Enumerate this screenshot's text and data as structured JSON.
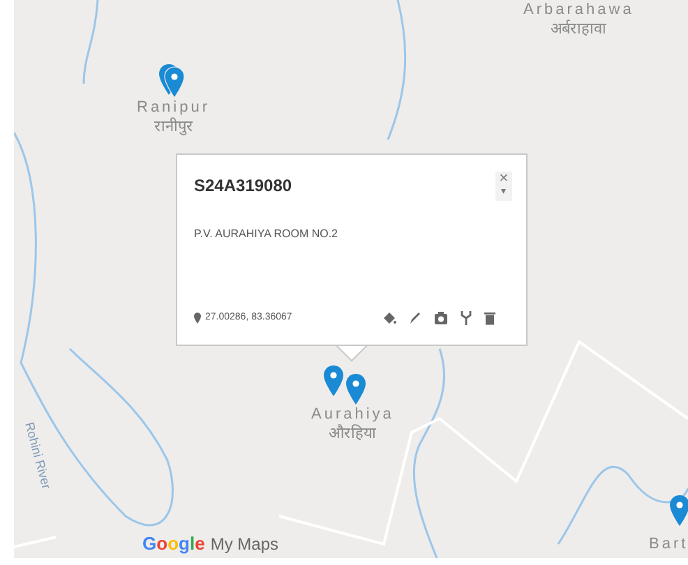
{
  "map": {
    "places": [
      {
        "name": "Arbarahawa",
        "local_name": "अर्बराहावा"
      },
      {
        "name": "Ranipur",
        "local_name": "रानीपुर"
      },
      {
        "name": "Aurahiya",
        "local_name": "औरहिया"
      },
      {
        "name": "Bart"
      }
    ],
    "river_label": "Rohini River",
    "logo": {
      "brand": "Google",
      "product": "My Maps"
    }
  },
  "popup": {
    "title": "S24A319080",
    "description": "P.V. AURAHIYA ROOM NO.2",
    "coordinates": "27.00286, 83.36067",
    "close": "×",
    "caret": "▾"
  }
}
